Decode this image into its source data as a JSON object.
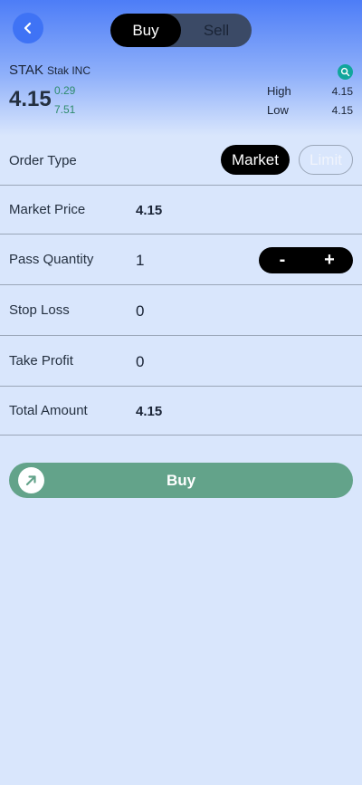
{
  "header": {
    "toggle": [
      {
        "label": "Buy",
        "active": true
      },
      {
        "label": "Sell",
        "active": false
      }
    ]
  },
  "stock": {
    "symbol": "STAK",
    "company": "Stak INC",
    "price": "4.15",
    "change_1": "0.29",
    "change_2": "7.51",
    "high_label": "High",
    "high_value": "4.15",
    "low_label": "Low",
    "low_value": "4.15"
  },
  "order": {
    "type_label": "Order Type",
    "market_label": "Market",
    "limit_label": "Limit",
    "market_price_label": "Market Price",
    "market_price_value": "4.15",
    "quantity_label": "Pass Quantity",
    "quantity_value": "1",
    "minus": "-",
    "plus": "+",
    "stop_loss_label": "Stop Loss",
    "stop_loss_value": "0",
    "take_profit_label": "Take Profit",
    "take_profit_value": "0",
    "total_label": "Total Amount",
    "total_value": "4.15"
  },
  "actions": {
    "buy_label": "Buy"
  },
  "icons": {
    "back": "chevron-left-icon",
    "search": "search-icon",
    "buy": "arrow-up-right-icon"
  },
  "colors": {
    "accent": "#3f73f5",
    "positive": "#2e8b6b",
    "buy_button": "#63a38a",
    "search": "#11a69c"
  }
}
